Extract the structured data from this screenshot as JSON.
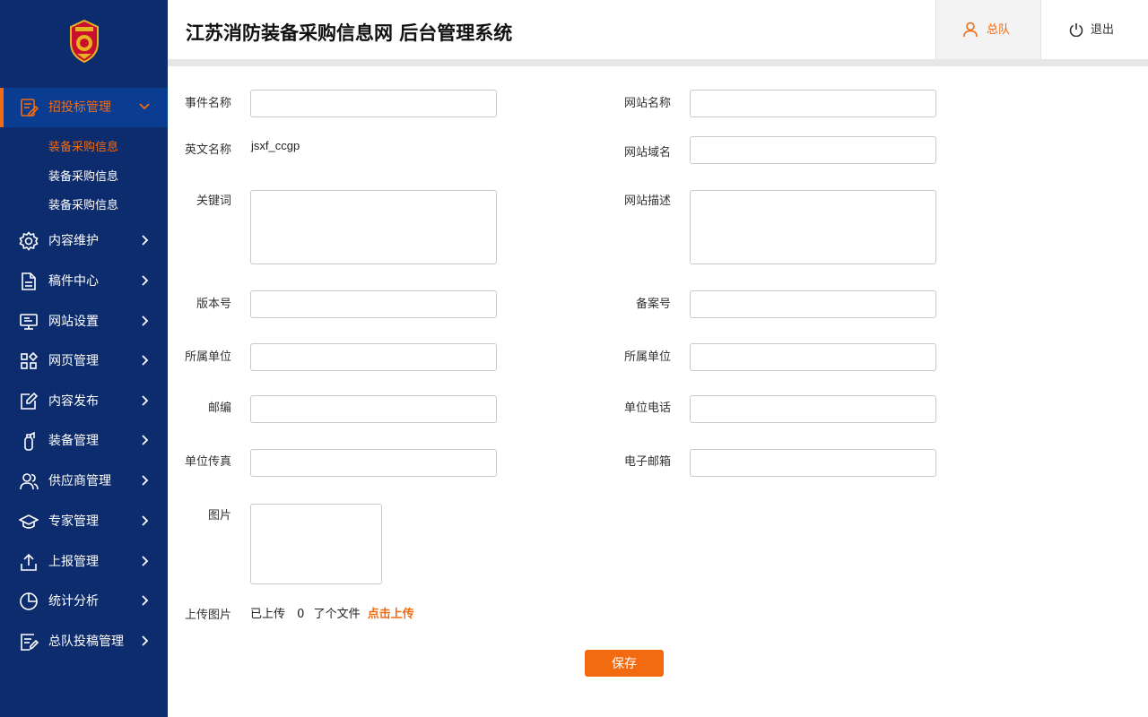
{
  "header": {
    "title": "江苏消防装备采购信息网  后台管理系统",
    "user_label": "总队",
    "logout_label": "退出"
  },
  "colors": {
    "sidebar": "#0d2c6e",
    "accent": "#f26b10",
    "active_item_bg": "#0a3d91"
  },
  "sidebar": {
    "items": [
      {
        "label": "招投标管理",
        "icon": "document-edit-icon",
        "active": true,
        "expanded": true
      },
      {
        "label": "内容维护",
        "icon": "gear-icon"
      },
      {
        "label": "稿件中心",
        "icon": "file-icon"
      },
      {
        "label": "网站设置",
        "icon": "monitor-icon"
      },
      {
        "label": "网页管理",
        "icon": "grid-icon"
      },
      {
        "label": "内容发布",
        "icon": "edit-square-icon"
      },
      {
        "label": "装备管理",
        "icon": "extinguisher-icon"
      },
      {
        "label": "供应商管理",
        "icon": "users-icon"
      },
      {
        "label": "专家管理",
        "icon": "graduation-cap-icon"
      },
      {
        "label": "上报管理",
        "icon": "upload-icon"
      },
      {
        "label": "统计分析",
        "icon": "pie-chart-icon"
      },
      {
        "label": "总队投稿管理",
        "icon": "list-edit-icon"
      }
    ],
    "sub_items": [
      {
        "label": "装备采购信息",
        "active": true
      },
      {
        "label": "装备采购信息",
        "active": false
      },
      {
        "label": "装备采购信息",
        "active": false
      }
    ]
  },
  "form": {
    "event_name": {
      "label": "事件名称",
      "value": ""
    },
    "english_name": {
      "label": "英文名称",
      "value": "jsxf_ccgp"
    },
    "keywords": {
      "label": "关键词",
      "value": ""
    },
    "version": {
      "label": "版本号",
      "value": ""
    },
    "unit_left": {
      "label": "所属单位",
      "value": ""
    },
    "postcode": {
      "label": "邮编",
      "value": ""
    },
    "fax": {
      "label": "单位传真",
      "value": ""
    },
    "image": {
      "label": "图片"
    },
    "site_name": {
      "label": "网站名称",
      "value": ""
    },
    "domain": {
      "label": "网站域名",
      "value": ""
    },
    "description": {
      "label": "网站描述",
      "value": ""
    },
    "icp": {
      "label": "备案号",
      "value": ""
    },
    "unit_right": {
      "label": "所属单位",
      "value": ""
    },
    "phone": {
      "label": "单位电话",
      "value": ""
    },
    "email": {
      "label": "电子邮箱",
      "value": ""
    },
    "upload": {
      "label": "上传图片",
      "prefix": "已上传",
      "count": "0",
      "suffix": "了个文件",
      "link": "点击上传"
    },
    "save_label": "保存"
  }
}
